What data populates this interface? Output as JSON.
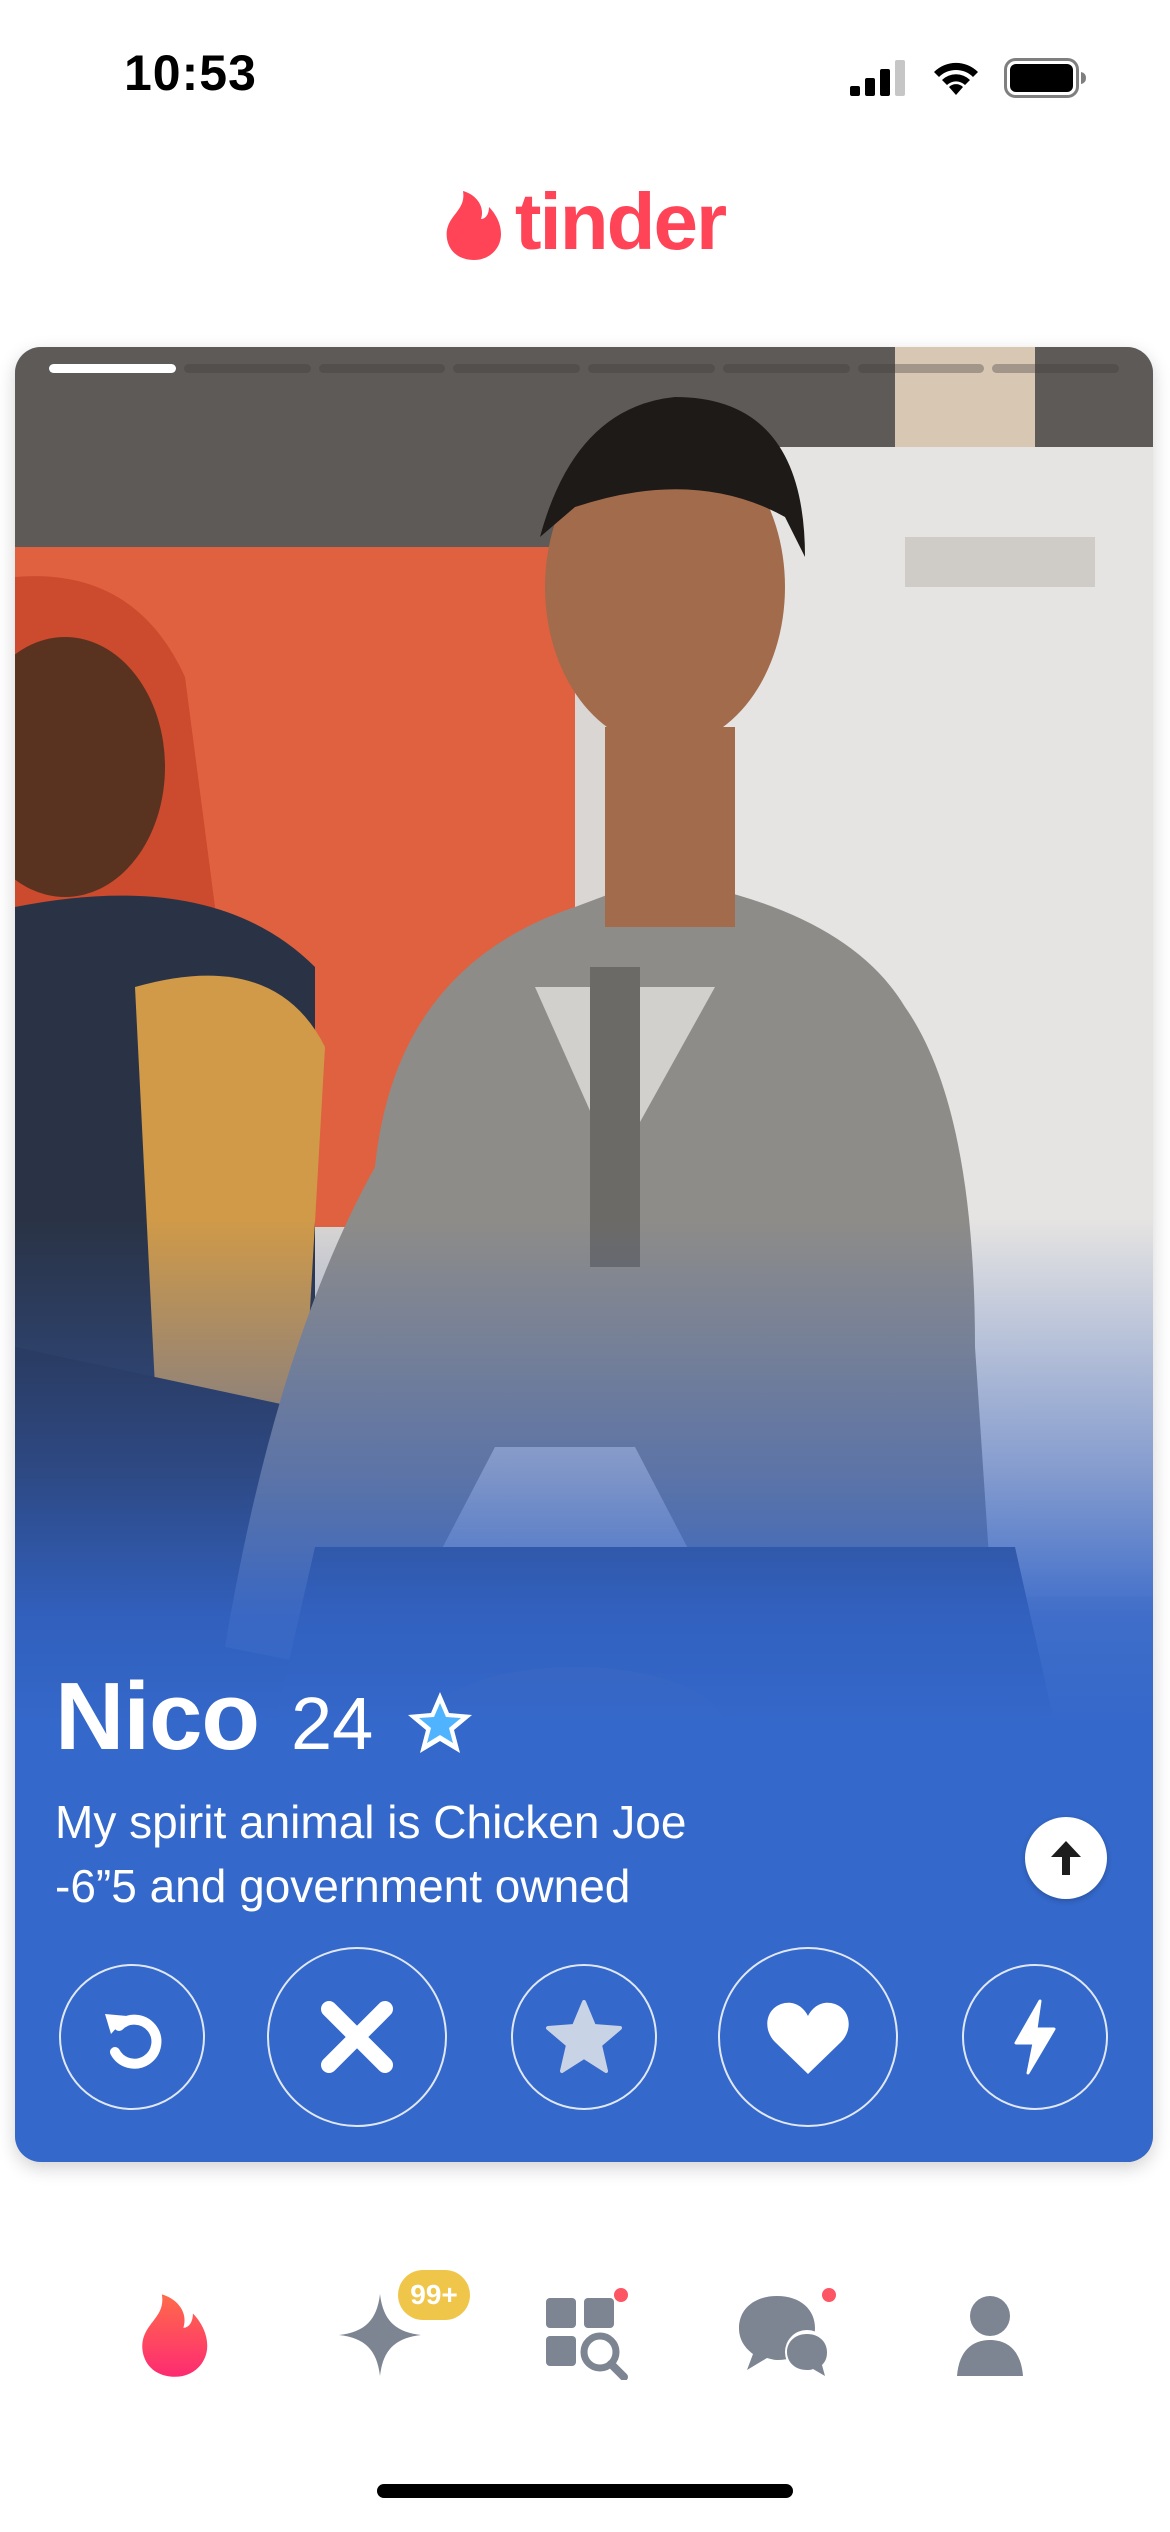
{
  "status_bar": {
    "time": "10:53",
    "icons": [
      "cellular-signal-icon",
      "wifi-icon",
      "battery-icon"
    ]
  },
  "header": {
    "logo_icon": "tinder-flame-icon",
    "logo_text": "tinder",
    "brand_color": "#ff4458"
  },
  "card": {
    "photo_count": 8,
    "active_photo_index": 0,
    "name": "Nico",
    "age": "24",
    "verified_icon": "verified-star-icon",
    "bio_lines": [
      "My spirit animal is Chicken Joe",
      "-6”5 and government owned"
    ],
    "expand_icon": "arrow-up-icon"
  },
  "actions": [
    {
      "name": "rewind-button",
      "icon": "rewind-icon"
    },
    {
      "name": "nope-button",
      "icon": "close-icon"
    },
    {
      "name": "super-like-button",
      "icon": "star-icon"
    },
    {
      "name": "like-button",
      "icon": "heart-icon"
    },
    {
      "name": "boost-button",
      "icon": "lightning-icon"
    }
  ],
  "tabbar": {
    "tabs": [
      {
        "name": "tab-home",
        "icon": "tinder-flame-icon"
      },
      {
        "name": "tab-gold",
        "icon": "sparkle-icon"
      },
      {
        "name": "tab-explore",
        "icon": "explore-icon"
      },
      {
        "name": "tab-messages",
        "icon": "chat-bubbles-icon"
      },
      {
        "name": "tab-profile",
        "icon": "person-icon"
      }
    ],
    "likes_badge": "99+"
  },
  "colors": {
    "card_blue": "#3468ca",
    "tab_inactive": "#7c8591",
    "badge_gold": "#f0c64a",
    "notification_dot": "#fd5564"
  }
}
